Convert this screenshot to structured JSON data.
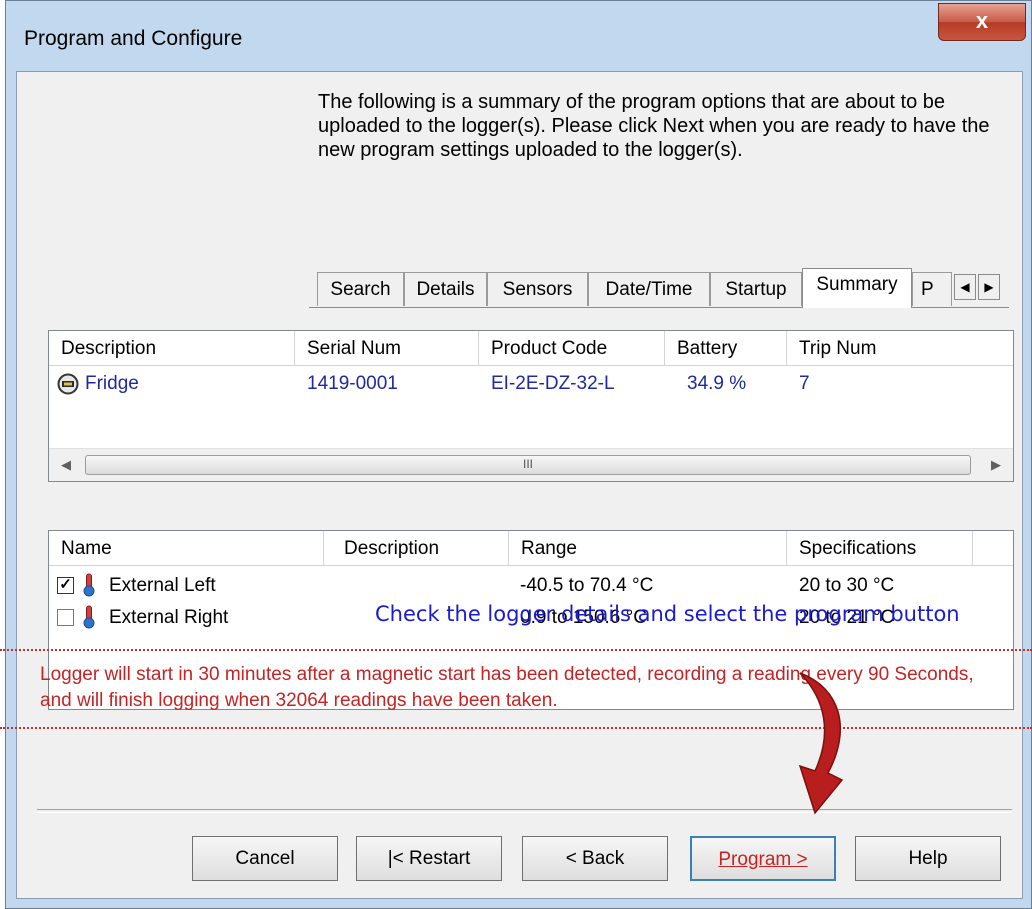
{
  "window": {
    "title": "Program and Configure",
    "close_glyph": "x"
  },
  "intro_text": "The following is a summary of the program options that are about to be uploaded to the logger(s). Please click Next when you are ready to have the new program settings uploaded to the logger(s).",
  "tabs": [
    {
      "label": "Search"
    },
    {
      "label": "Details"
    },
    {
      "label": "Sensors"
    },
    {
      "label": "Date/Time"
    },
    {
      "label": "Startup"
    },
    {
      "label": "Summary",
      "active": true
    },
    {
      "label": "P"
    }
  ],
  "tab_scroll": {
    "left": "◀",
    "right": "▶"
  },
  "logger_table": {
    "columns": [
      "Description",
      "Serial Num",
      "Product Code",
      "Battery",
      "Trip Num"
    ],
    "rows": [
      {
        "icon": "logger-icon",
        "description": "Fridge",
        "serial": "1419-0001",
        "product_code": "EI-2E-DZ-32-L",
        "battery": "34.9 %",
        "trip": "7"
      }
    ],
    "scroll_thumb_grip": "III"
  },
  "sensor_table": {
    "columns": [
      "Name",
      "Description",
      "Range",
      "Specifications"
    ],
    "rows": [
      {
        "checked": true,
        "icon": "thermometer-icon",
        "name": "External Left",
        "description": "",
        "range": "-40.5 to 70.4 °C",
        "specs": "20 to 30 °C"
      },
      {
        "checked": false,
        "icon": "thermometer-icon",
        "name": "External Right",
        "description": "",
        "range": "0.9 to 150.6 °C",
        "specs": "20 to 21 °C"
      }
    ]
  },
  "annotation": "Check the logger details and select the program button",
  "status_text": "Logger will start in 30 minutes after a magnetic start has been detected, recording a reading every 90 Seconds, and will finish logging when 32064 readings have been taken.",
  "buttons": {
    "cancel": "Cancel",
    "restart": "|< Restart",
    "back": "< Back",
    "program": "Program >",
    "help": "Help"
  },
  "colors": {
    "accent_red": "#c42424",
    "link_blue": "#1f2a9c",
    "annotation_blue": "#1a1acf",
    "frame": "#c2d8ef"
  }
}
